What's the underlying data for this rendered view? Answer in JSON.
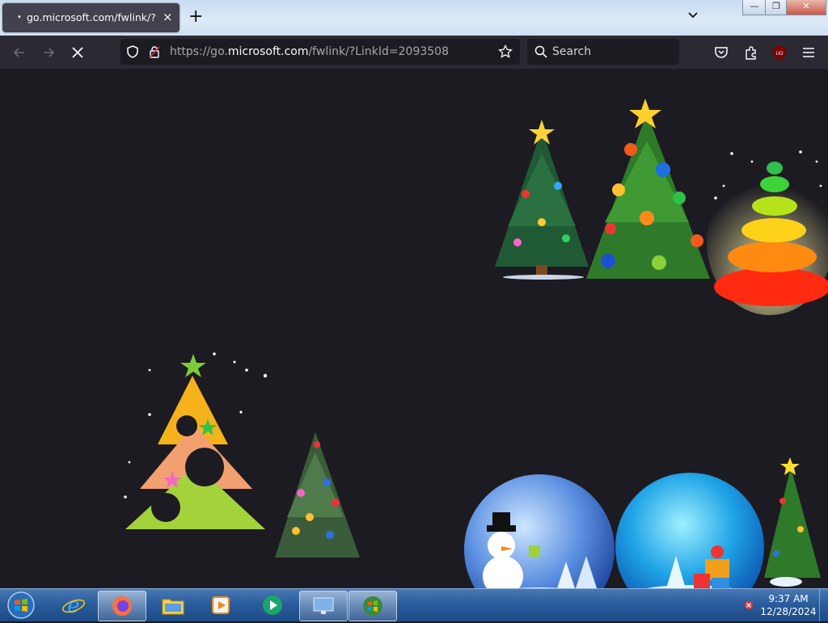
{
  "browser": {
    "tab": {
      "title": "go.microsoft.com/fwlink/?LinkI",
      "indicator": "•",
      "close_icon": "×"
    },
    "new_tab_icon": "+",
    "url": {
      "prefix": "https://go.",
      "domain": "microsoft.com",
      "suffix": "/fwlink/?LinkId=2093508"
    },
    "search_placeholder": "Search"
  },
  "window_controls": {
    "minimize": "—",
    "restore": "❐",
    "close": "✕"
  },
  "taskbar": {
    "apps": [
      {
        "name": "start-orb"
      },
      {
        "name": "internet-explorer"
      },
      {
        "name": "firefox",
        "active": true
      },
      {
        "name": "windows-explorer"
      },
      {
        "name": "media-player"
      },
      {
        "name": "media-center"
      },
      {
        "name": "remote-desktop"
      },
      {
        "name": "windows-live",
        "active": true
      }
    ],
    "clock": {
      "time": "9:37 AM",
      "date": "12/28/2024"
    }
  },
  "colors": {
    "page_background": "#1c1b22",
    "toolbar": "#2b2a33",
    "tab_active": "#42414d"
  }
}
